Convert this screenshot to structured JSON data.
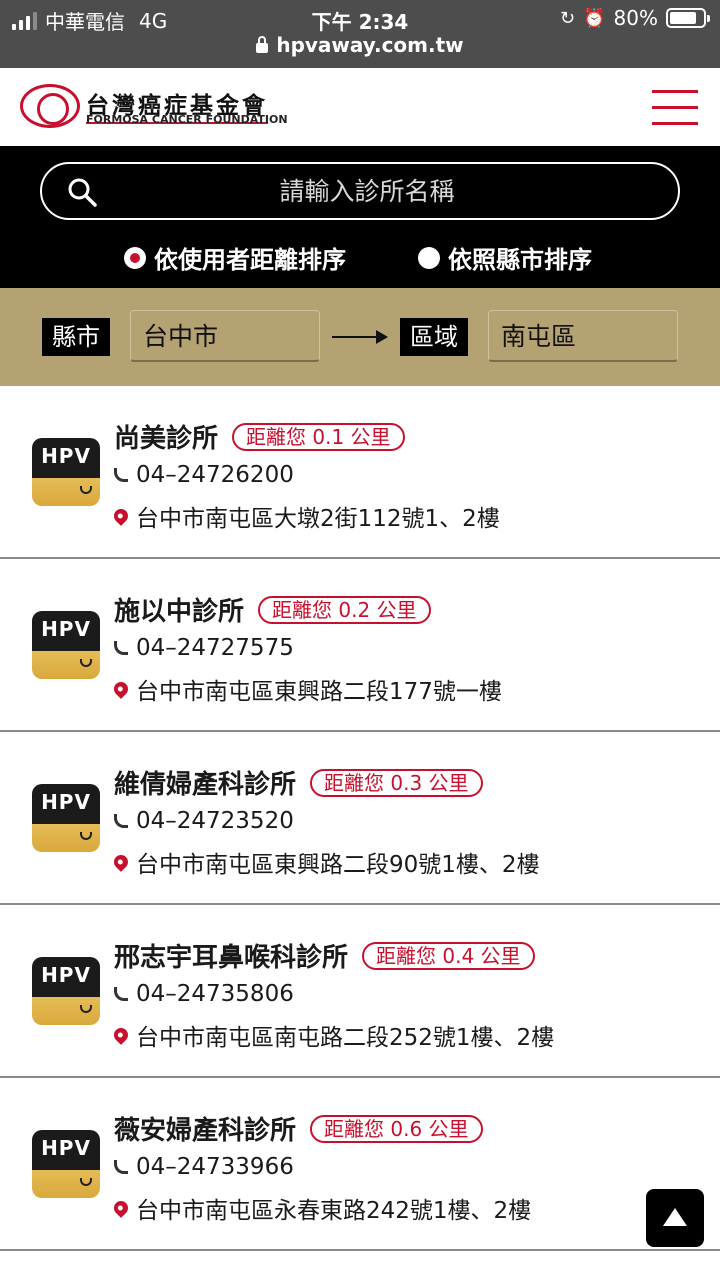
{
  "status_bar": {
    "carrier": "中華電信",
    "network": "4G",
    "time": "下午 2:34",
    "battery": "80%",
    "battery_level": 0.8
  },
  "browser": {
    "url": "hpvaway.com.tw"
  },
  "header": {
    "logo_zh": "台灣癌症基金會",
    "logo_en": "FORMOSA CANCER FOUNDATION"
  },
  "search": {
    "placeholder": "請輸入診所名稱",
    "sort_options": [
      {
        "label": "依使用者距離排序",
        "selected": true
      },
      {
        "label": "依照縣市排序",
        "selected": false
      }
    ]
  },
  "filter": {
    "city_label": "縣市",
    "city_value": "台中市",
    "area_label": "區域",
    "area_value": "南屯區"
  },
  "badge_text": "HPV",
  "clinics": [
    {
      "name": "尚美診所",
      "distance": "距離您 0.1 公里",
      "phone": "04–24726200",
      "address": "台中市南屯區大墩2街112號1、2樓"
    },
    {
      "name": "施以中診所",
      "distance": "距離您 0.2 公里",
      "phone": "04–24727575",
      "address": "台中市南屯區東興路二段177號一樓"
    },
    {
      "name": "維倩婦產科診所",
      "distance": "距離您 0.3 公里",
      "phone": "04–24723520",
      "address": "台中市南屯區東興路二段90號1樓、2樓"
    },
    {
      "name": "邢志宇耳鼻喉科診所",
      "distance": "距離您 0.4 公里",
      "phone": "04–24735806",
      "address": "台中市南屯區南屯路二段252號1樓、2樓"
    },
    {
      "name": "薇安婦產科診所",
      "distance": "距離您 0.6 公里",
      "phone": "04–24733966",
      "address": "台中市南屯區永春東路242號1樓、2樓"
    }
  ]
}
